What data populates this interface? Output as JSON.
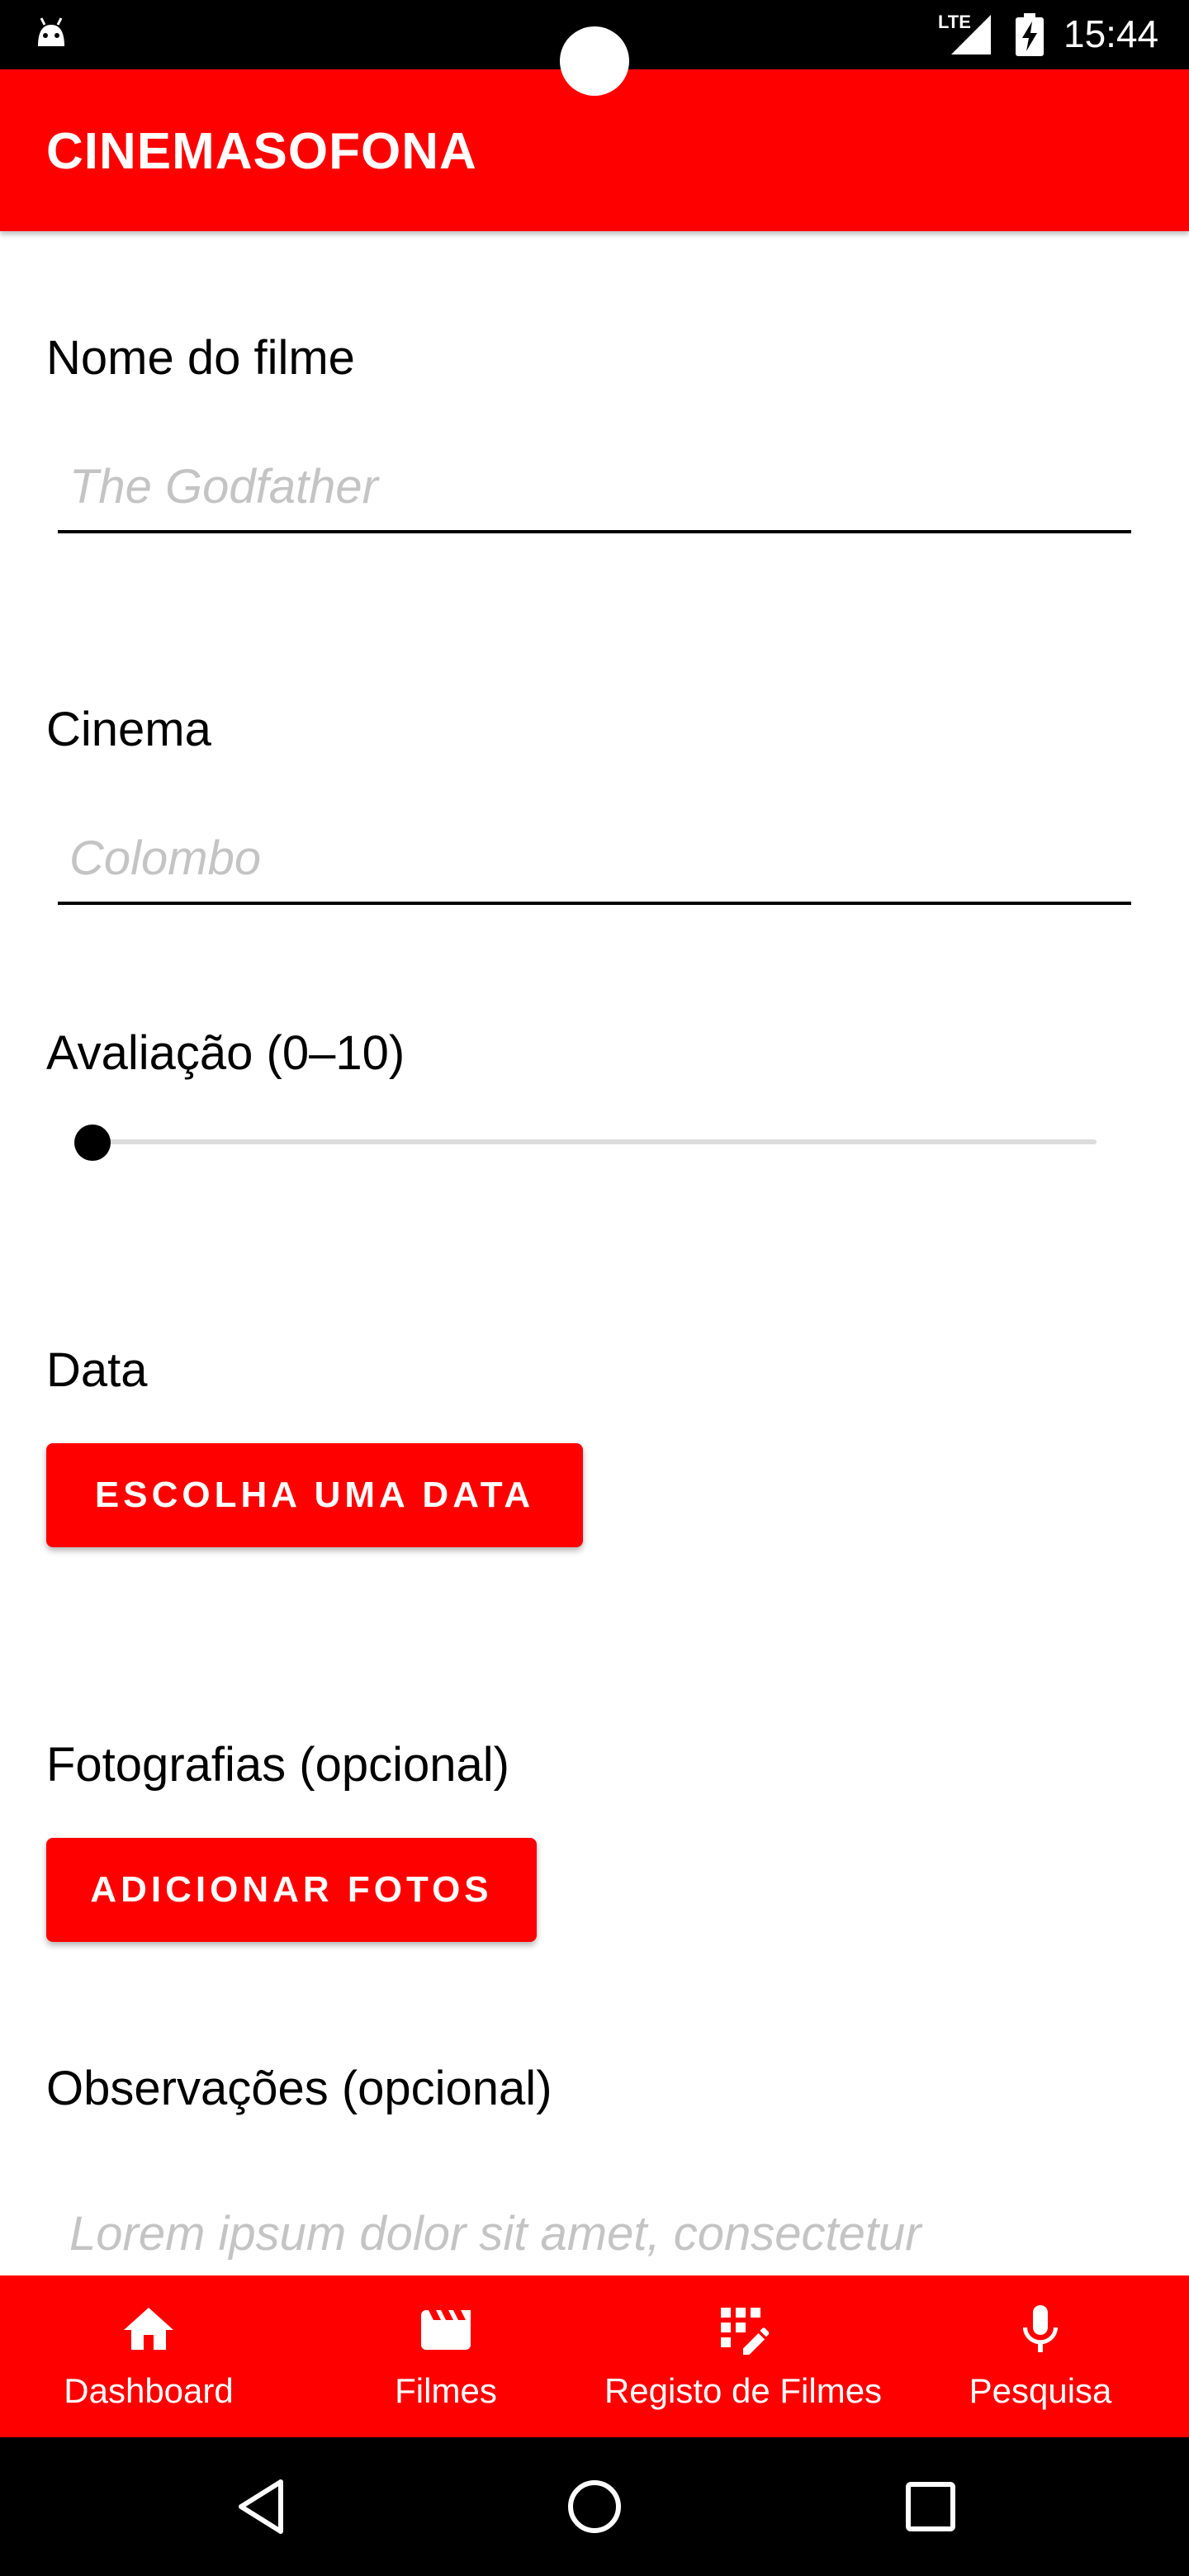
{
  "status_bar": {
    "time": "15:44",
    "network": "LTE",
    "icons": [
      "android-icon",
      "signal-icon",
      "battery-charging-icon"
    ]
  },
  "app_bar": {
    "title": "CINEMASOFONA"
  },
  "form": {
    "movie_name": {
      "label": "Nome do filme",
      "placeholder": "The Godfather"
    },
    "cinema": {
      "label": "Cinema",
      "placeholder": "Colombo"
    },
    "rating": {
      "label": "Avaliação (0–10)",
      "value": 0,
      "min": 0,
      "max": 10
    },
    "date": {
      "label": "Data",
      "button": "ESCOLHA UMA DATA"
    },
    "photos": {
      "label": "Fotografias (opcional)",
      "button": "ADICIONAR FOTOS"
    },
    "notes": {
      "label": "Observações (opcional)",
      "placeholder": "Lorem ipsum dolor sit amet, consectetur"
    }
  },
  "bottom_nav": {
    "items": [
      {
        "label": "Dashboard",
        "icon": "home-icon"
      },
      {
        "label": "Filmes",
        "icon": "movie-clapper-icon"
      },
      {
        "label": "Registo de Filmes",
        "icon": "edit-grid-icon"
      },
      {
        "label": "Pesquisa",
        "icon": "microphone-icon"
      }
    ]
  },
  "system_nav": {
    "icons": [
      "back-icon",
      "home-circle-icon",
      "recents-icon"
    ]
  },
  "colors": {
    "primary": "#ff0000",
    "hint": "#c4c4c4"
  }
}
